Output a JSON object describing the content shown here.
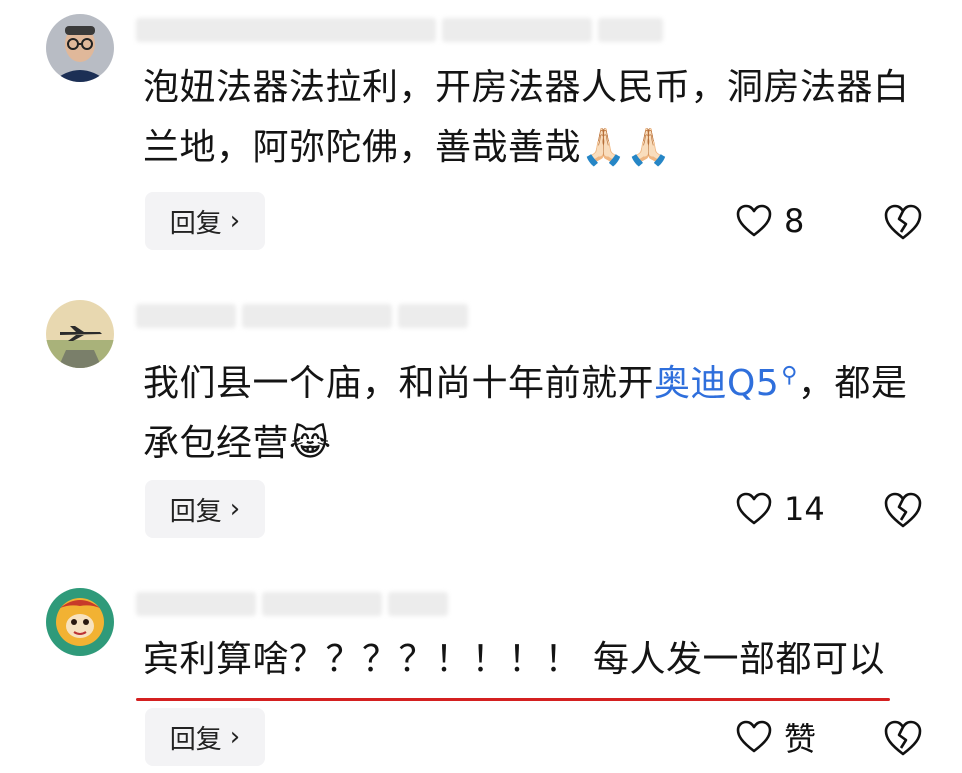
{
  "comments": [
    {
      "text": "泡妞法器法拉利，开房法器人民币，洞房法器白兰地，阿弥陀佛，善哉善哉🙏🏻🙏🏻",
      "reply_label": "回复",
      "reply_chevron": "›",
      "likes": "8",
      "avatar": "man-with-glasses-avatar"
    },
    {
      "text_before": "我们县一个庙，和尚十年前就开",
      "link": "奥迪Q5",
      "link_icon": "search-icon",
      "text_after": "，都是承包经营😹",
      "reply_label": "回复",
      "reply_chevron": "›",
      "likes": "14",
      "avatar": "airplane-avatar"
    },
    {
      "text": "宾利算啥？？？？！！！！ 每人发一部都可以",
      "reply_label": "回复",
      "reply_chevron": "›",
      "likes": "赞",
      "avatar": "monkey-king-avatar"
    }
  ],
  "colors": {
    "link": "#2f6fdc",
    "underline": "#d42020",
    "reply_bg": "#f3f3f5"
  },
  "icons": {
    "like": "heart-outline-icon",
    "dislike": "broken-heart-icon"
  }
}
